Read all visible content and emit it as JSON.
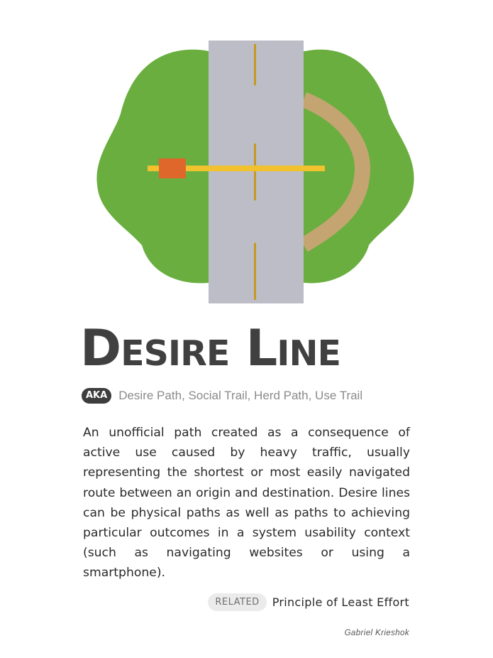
{
  "title": "Desire Line",
  "aka": {
    "badge": "AKA",
    "text": "Desire Path, Social Trail, Herd Path, Use Trail"
  },
  "description": "An unofficial path created as a consequence of active use caused by heavy traffic, usually representing the shortest or most easily navigated route between an origin and destination. Desire lines can be physical paths as well as paths to achieving particular outcomes in a system usability context (such as navigating websites or using a smartphone).",
  "related": {
    "badge": "RELATED",
    "text": "Principle of Least Effort"
  },
  "author": "Gabriel Krieshok",
  "colors": {
    "grass": "#6aae3f",
    "road": "#bcbdc6",
    "road_marking": "#c79a1e",
    "dirt_path": "#c4a572",
    "desire_line": "#f2c12e",
    "marker": "#e0672b",
    "title_text": "#404040"
  }
}
